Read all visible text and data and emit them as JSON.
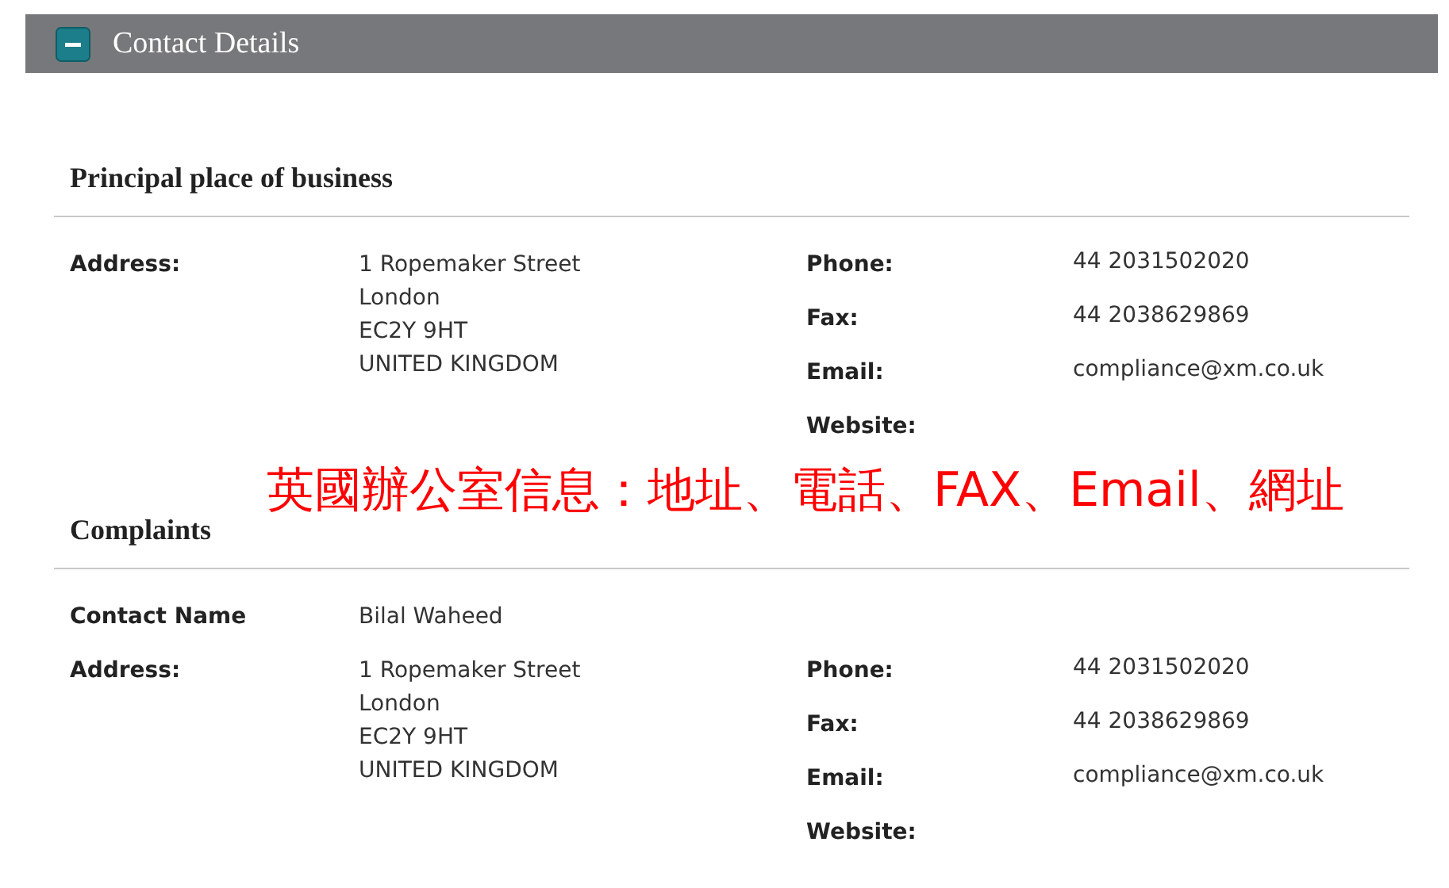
{
  "panel": {
    "title": "Contact Details",
    "expanded": true
  },
  "sections": [
    {
      "heading": "Principal place of business",
      "address": {
        "label": "Address:",
        "lines": [
          "1 Ropemaker Street",
          "London",
          "EC2Y 9HT",
          "UNITED KINGDOM"
        ]
      },
      "details": [
        {
          "label": "Phone:",
          "value": "44 2031502020"
        },
        {
          "label": "Fax:",
          "value": "44 2038629869"
        },
        {
          "label": "Email:",
          "value": "compliance@xm.co.uk"
        },
        {
          "label": "Website:"
        }
      ]
    },
    {
      "heading": "Complaints",
      "contact": {
        "label": "Contact Name",
        "value": "Bilal Waheed"
      },
      "address": {
        "label": "Address:",
        "lines": [
          "1 Ropemaker Street",
          "London",
          "EC2Y 9HT",
          "UNITED KINGDOM"
        ]
      },
      "details": [
        {
          "label": "Phone:",
          "value": "44 2031502020"
        },
        {
          "label": "Fax:",
          "value": "44 2038629869"
        },
        {
          "label": "Email:",
          "value": "compliance@xm.co.uk"
        },
        {
          "label": "Website:"
        }
      ]
    }
  ],
  "annotation": "英國辦公室信息：地址、電話、FAX、Email、網址"
}
